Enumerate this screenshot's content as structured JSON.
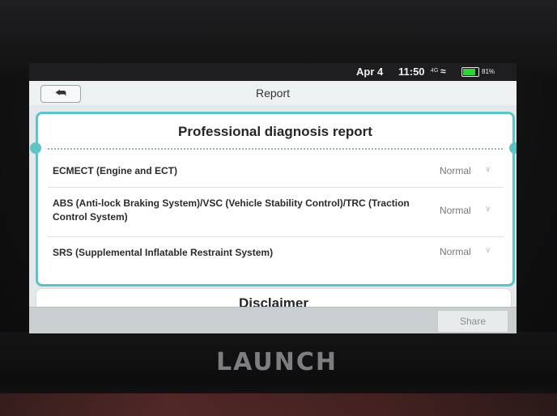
{
  "device": {
    "brand": "LAUNCH"
  },
  "status_bar": {
    "date": "Apr 4",
    "time": "11:50",
    "network": "4G",
    "wifi_icon": "wifi-icon",
    "battery_level": 0.81,
    "battery_percent": "81%"
  },
  "header": {
    "back_icon": "back-arrow-icon",
    "title": "Report"
  },
  "report": {
    "title": "Professional diagnosis report",
    "rows": [
      {
        "label": "ECMECT (Engine and ECT)",
        "status": "Normal"
      },
      {
        "label": "ABS (Anti-lock Braking System)/VSC (Vehicle Stability Control)/TRC (Traction Control System)",
        "status": "Normal"
      },
      {
        "label": "SRS (Supplemental Inflatable Restraint System)",
        "status": "Normal"
      }
    ]
  },
  "disclaimer": {
    "title": "Disclaimer"
  },
  "footer": {
    "share_label": "Share"
  },
  "colors": {
    "accent": "#5ec3c4",
    "battery": "#35d13a"
  }
}
